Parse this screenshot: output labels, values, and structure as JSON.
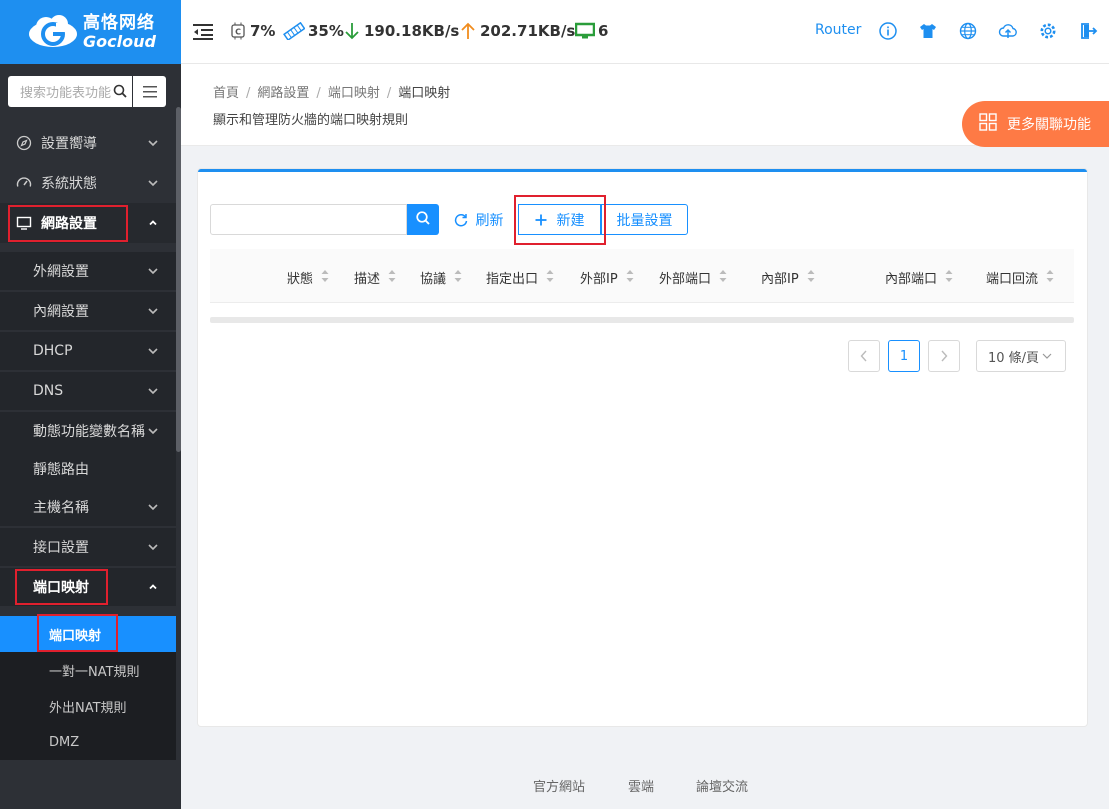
{
  "brand": {
    "name_cn": "高恪网络",
    "name_en": "Gocloud"
  },
  "sidebar": {
    "search_placeholder": "搜索功能表功能",
    "items": [
      {
        "label": "設置嚮導",
        "icon": "compass-icon"
      },
      {
        "label": "系統狀態",
        "icon": "dashboard-icon"
      },
      {
        "label": "網路設置",
        "icon": "monitor-icon"
      }
    ],
    "sub_items": [
      {
        "label": "外網設置"
      },
      {
        "label": "內網設置"
      },
      {
        "label": "DHCP"
      },
      {
        "label": "DNS"
      },
      {
        "label": "動態功能變數名稱"
      },
      {
        "label": "靜態路由"
      },
      {
        "label": "主機名稱"
      },
      {
        "label": "接口設置"
      },
      {
        "label": "端口映射"
      }
    ],
    "sub2_items": [
      {
        "label": "端口映射"
      },
      {
        "label": "一對一NAT規則"
      },
      {
        "label": "外出NAT規則"
      },
      {
        "label": "DMZ"
      }
    ]
  },
  "header": {
    "cpu": "7%",
    "memory": "35%",
    "download": "190.18KB/s",
    "upload": "202.71KB/s",
    "devices": "6",
    "router_label": "Router"
  },
  "breadcrumb": {
    "items": [
      "首頁",
      "網路設置",
      "端口映射"
    ],
    "current": "端口映射"
  },
  "page_description": "顯示和管理防火牆的端口映射規則",
  "more_button": "更多關聯功能",
  "toolbar": {
    "refresh": "刷新",
    "new": "新建",
    "batch": "批量設置"
  },
  "table": {
    "columns": [
      "狀態",
      "描述",
      "協議",
      "指定出口",
      "外部IP",
      "外部端口",
      "內部IP",
      "內部端口",
      "端口回流"
    ]
  },
  "pagination": {
    "page": "1",
    "page_size": "10 條/頁"
  },
  "footer": {
    "links": [
      "官方網站",
      "雲端",
      "論壇交流"
    ]
  },
  "colors": {
    "primary": "#1890ff",
    "sidebar_bg": "#2d3036",
    "accent_orange": "#fe7a45",
    "highlight": "#e0202e"
  }
}
